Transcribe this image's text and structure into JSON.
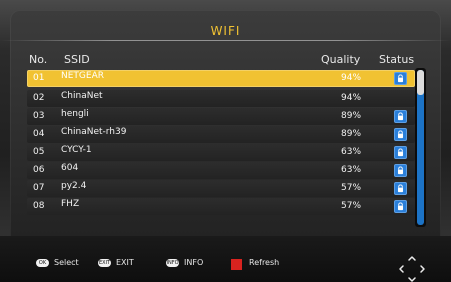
{
  "title": "WIFI",
  "columns": {
    "no": "No.",
    "ssid": "SSID",
    "quality": "Quality",
    "status": "Status"
  },
  "networks": [
    {
      "no": "01",
      "ssid": "NETGEAR",
      "quality": "94%",
      "locked": true,
      "selected": true
    },
    {
      "no": "02",
      "ssid": "ChinaNet",
      "quality": "94%",
      "locked": false,
      "selected": false
    },
    {
      "no": "03",
      "ssid": "hengli",
      "quality": "89%",
      "locked": true,
      "selected": false
    },
    {
      "no": "04",
      "ssid": "ChinaNet-rh39",
      "quality": "89%",
      "locked": true,
      "selected": false
    },
    {
      "no": "05",
      "ssid": "CYCY-1",
      "quality": "63%",
      "locked": true,
      "selected": false
    },
    {
      "no": "06",
      "ssid": "604",
      "quality": "63%",
      "locked": true,
      "selected": false
    },
    {
      "no": "07",
      "ssid": "py2.4",
      "quality": "57%",
      "locked": true,
      "selected": false
    },
    {
      "no": "08",
      "ssid": "FHZ",
      "quality": "57%",
      "locked": true,
      "selected": false
    }
  ],
  "hints": {
    "ok_key": "OK",
    "ok_label": "Select",
    "exit_key": "EXIT",
    "exit_label": "EXIT",
    "info_key": "INFO",
    "info_label": "INFO",
    "red_label": "Refresh"
  },
  "colors": {
    "accent": "#f1c232",
    "lock_blue": "#2a7fda",
    "scroll_blue": "#1c73c6",
    "red": "#d9231f"
  },
  "icons": {
    "lock": "lock-icon",
    "dpad": "dpad-icon"
  }
}
